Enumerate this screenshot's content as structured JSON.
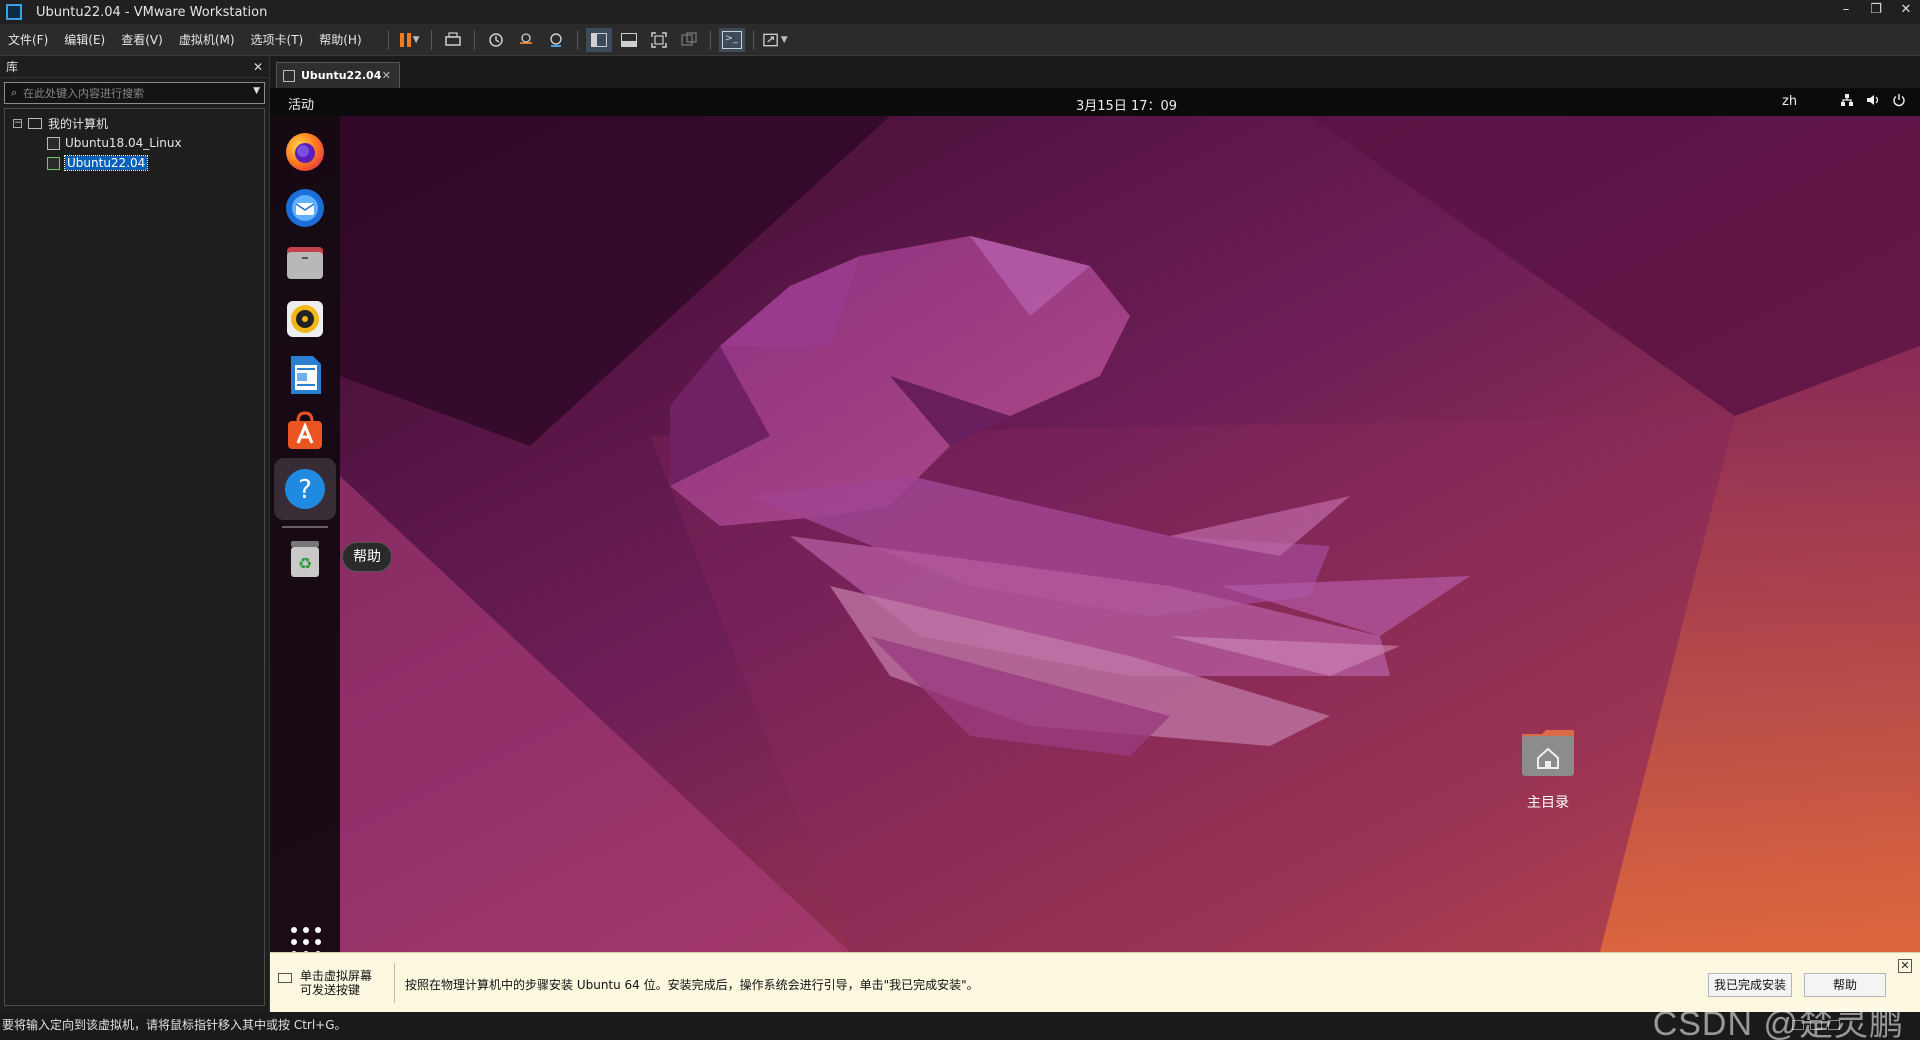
{
  "window": {
    "title": "Ubuntu22.04 - VMware Workstation",
    "controls": [
      "–",
      "❐",
      "✕"
    ]
  },
  "menu": {
    "items": [
      "文件(F)",
      "编辑(E)",
      "查看(V)",
      "虚拟机(M)",
      "选项卡(T)",
      "帮助(H)"
    ]
  },
  "toolbar": {
    "icons": [
      "pause-icon",
      "send-ctrl-alt-del-icon",
      "snapshot-icon",
      "revert-snapshot-icon",
      "snapshot-manager-icon",
      "library-view-icon",
      "thumbnail-view-icon",
      "fullscreen-icon",
      "unity-icon",
      "console-icon",
      "stretch-icon"
    ],
    "accent": "#f07a1e"
  },
  "library": {
    "title": "库",
    "close": "✕",
    "search_placeholder": "在此处键入内容进行搜索",
    "root": {
      "toggle": "−",
      "label": "我的计算机",
      "children": [
        {
          "label": "Ubuntu18.04_Linux",
          "selected": false
        },
        {
          "label": "Ubuntu22.04",
          "selected": true
        }
      ]
    }
  },
  "tab": {
    "label": "Ubuntu22.04",
    "close": "✕"
  },
  "guest": {
    "topbar": {
      "activities": "活动",
      "clock": "3月15日  17：09",
      "input_method": "zh",
      "sys_icons": [
        "network-icon",
        "volume-icon",
        "power-icon"
      ]
    },
    "dock": {
      "apps": [
        "firefox-icon",
        "thunderbird-icon",
        "files-icon",
        "rhythmbox-icon",
        "libreoffice-writer-icon",
        "app-center-icon",
        "help-icon",
        "trash-icon"
      ],
      "active": "help-icon",
      "tooltip": "帮助",
      "show_apps_icon": "show-apps-icon"
    },
    "desktop": {
      "home_label": "主目录"
    }
  },
  "hint": {
    "left_line1": "单击虚拟屏幕",
    "left_line2": "可发送按键",
    "message": "按照在物理计算机中的步骤安装 Ubuntu 64 位。安装完成后，操作系统会进行引导，单击\"我已完成安装\"。",
    "done_button": "我已完成安装",
    "help_button": "帮助",
    "close": "✕"
  },
  "status": {
    "text": "要将输入定向到该虚拟机，请将鼠标指针移入其中或按 Ctrl+G。",
    "watermark": "CSDN @楚灵鹏"
  }
}
